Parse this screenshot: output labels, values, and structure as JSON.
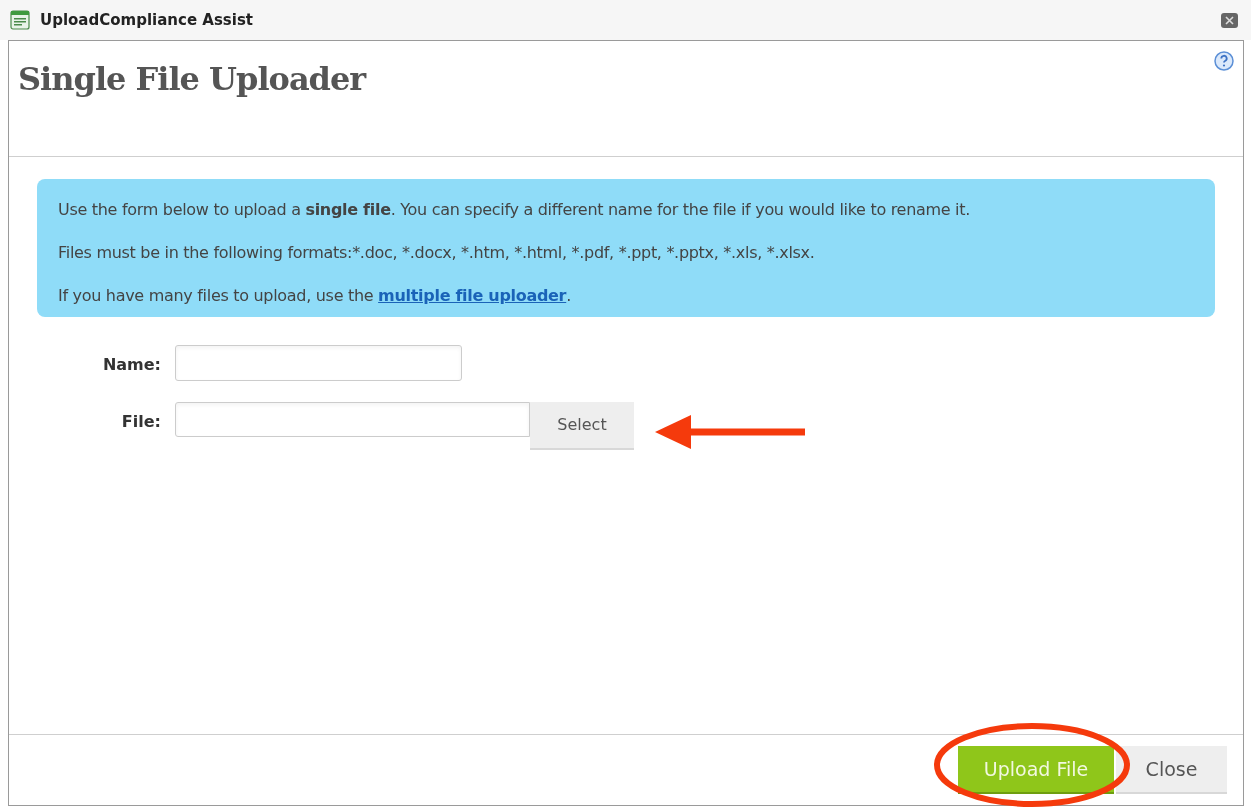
{
  "window": {
    "title": "UploadCompliance Assist"
  },
  "dialog": {
    "heading": "Single File Uploader"
  },
  "info": {
    "lines": [
      {
        "kind": "text",
        "text": "Use the form below to upload a **single file**. You can specify a different name for the file if you would like to rename it."
      },
      {
        "kind": "text",
        "text": "Files must be in the following formats:*.doc, *.docx, *.htm, *.html, *.pdf, *.ppt, *.pptx, *.xls, *.xlsx."
      },
      {
        "kind": "link",
        "before": "If you have many files to upload, use the ",
        "link": "multiple file uploader",
        "after": "."
      }
    ]
  },
  "form": {
    "fields": [
      {
        "kind": "text",
        "label": "Name:"
      },
      {
        "kind": "file",
        "label": "File:",
        "button": "Select"
      }
    ]
  },
  "footer": {
    "buttons": [
      {
        "label": "Upload File",
        "primary": true
      },
      {
        "label": "Close",
        "primary": false
      }
    ]
  }
}
